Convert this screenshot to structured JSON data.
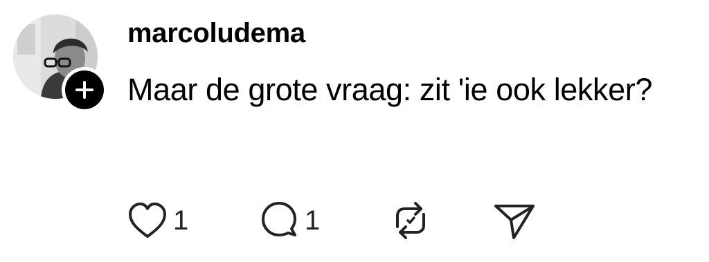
{
  "post": {
    "username": "marcoludema",
    "text": "Maar de grote vraag: zit 'ie ook lekker?",
    "likes": "1",
    "replies": "1"
  },
  "icons": {
    "follow": "plus-icon",
    "like": "heart-icon",
    "reply": "speech-bubble-icon",
    "repost": "repost-arrows-icon",
    "share": "paper-plane-icon"
  },
  "colors": {
    "text": "#000000",
    "icon": "#222222",
    "background": "#ffffff"
  }
}
